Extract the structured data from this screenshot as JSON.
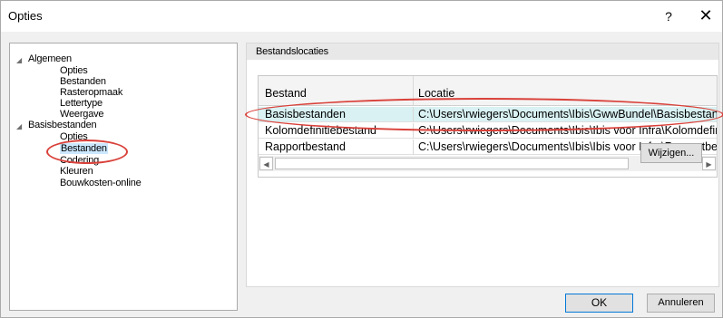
{
  "window": {
    "title": "Opties",
    "help_label": "?",
    "close_label": "✕"
  },
  "tree": {
    "groups": [
      {
        "label": "Algemeen",
        "expanded": true,
        "children": [
          "Opties",
          "Bestanden",
          "Rasteropmaak",
          "Lettertype",
          "Weergave"
        ]
      },
      {
        "label": "Basisbestanden",
        "expanded": true,
        "children": [
          "Opties",
          "Bestanden",
          "Codering",
          "Kleuren",
          "Bouwkosten-online"
        ]
      }
    ],
    "selected": "Basisbestanden / Bestanden"
  },
  "panel": {
    "header": "Bestandslocaties",
    "columns": [
      "Bestand",
      "Locatie"
    ],
    "rows": [
      {
        "bestand": "Basisbestanden",
        "locatie": "C:\\Users\\rwiegers\\Documents\\Ibis\\GwwBundel\\Basisbestan",
        "selected": true
      },
      {
        "bestand": "Kolomdefinitiebestand",
        "locatie": "C:\\Users\\rwiegers\\Documents\\Ibis\\Ibis voor Infra\\Kolomdefin",
        "selected": false
      },
      {
        "bestand": "Rapportbestand",
        "locatie": "C:\\Users\\rwiegers\\Documents\\Ibis\\Ibis voor Infra\\Rapportbes",
        "selected": false
      }
    ],
    "edit_button": "Wijzigen..."
  },
  "footer": {
    "ok": "OK",
    "cancel": "Annuleren"
  },
  "colors": {
    "highlight_circle": "#d9413a",
    "selected_row": "#d9f1f2",
    "tree_selection": "#cce8ff"
  }
}
